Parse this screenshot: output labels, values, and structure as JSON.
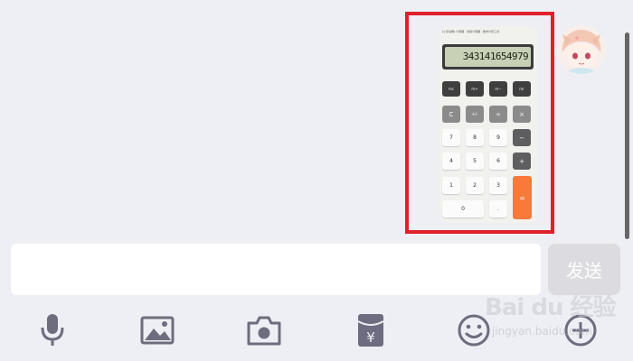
{
  "message": {
    "image": {
      "header_text": "[小字说明] 计算器 · 简易计算器 · 数学计算工具",
      "display_value": "343141654979",
      "memory_keys": [
        "mc",
        "m+",
        "m−",
        "mr"
      ],
      "operator_keys": [
        "C",
        "+/-",
        "÷",
        "×"
      ],
      "right_keys": [
        "−",
        "+"
      ],
      "digit_rows": [
        [
          "7",
          "8",
          "9"
        ],
        [
          "4",
          "5",
          "6"
        ],
        [
          "1",
          "2",
          "3"
        ]
      ],
      "zero_key": "0",
      "dot_key": ".",
      "equals_key": "=",
      "display_color": "#c8d0b6",
      "equals_color": "#f77a3b"
    },
    "highlight_color": "#e0202a"
  },
  "input": {
    "value": "",
    "placeholder": ""
  },
  "send_button": {
    "label": "发送"
  },
  "toolbar": {
    "icons": [
      "microphone-icon",
      "image-icon",
      "camera-icon",
      "red-packet-icon",
      "emoji-icon",
      "plus-icon"
    ]
  },
  "watermark": {
    "text": "Bai du 经验",
    "sub": "jingyan.baidu.com"
  }
}
